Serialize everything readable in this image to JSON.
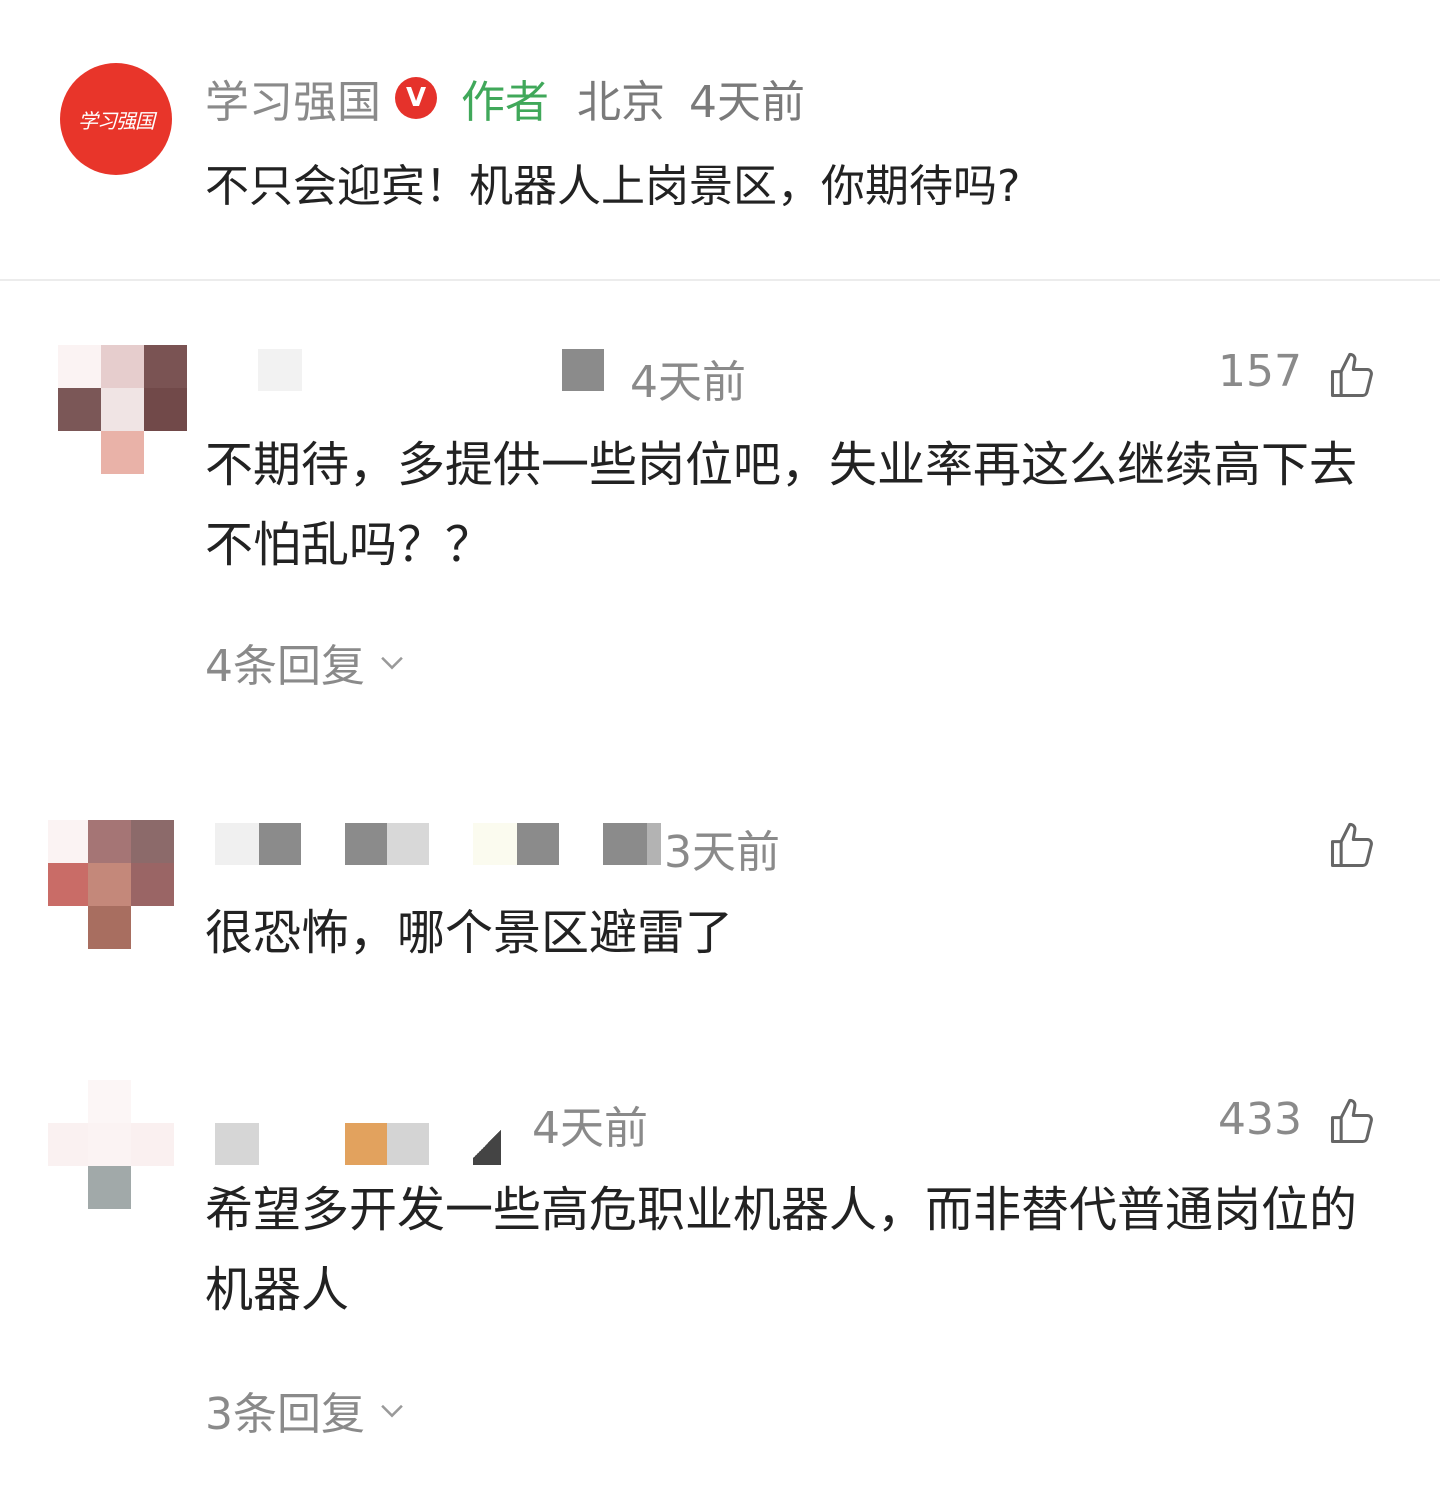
{
  "post": {
    "avatar_label": "学习强国",
    "author": "学习强国",
    "verified_badge": "V",
    "author_tag": "作者",
    "location": "北京",
    "time": "4天前",
    "title": "不只会迎宾！机器人上岗景区，你期待吗?"
  },
  "comments": [
    {
      "time": "4天前",
      "likes": "157",
      "text": "不期待，多提供一些岗位吧，失业率再这么继续高下去不怕乱吗？？",
      "replies": "4条回复"
    },
    {
      "time": "3天前",
      "likes": "",
      "text": "很恐怖，哪个景区避雷了",
      "replies": ""
    },
    {
      "time": "4天前",
      "likes": "433",
      "text": "希望多开发一些高危职业机器人，而非替代普通岗位的机器人",
      "replies": "3条回复"
    }
  ],
  "icons": {
    "like": "thumbs-up-icon",
    "expand": "chevron-down-icon",
    "verified": "verified-badge-icon"
  },
  "colors": {
    "brand_red": "#e8352a",
    "author_green": "#40a85a",
    "meta_gray": "#8a8a8a",
    "text": "#222222"
  }
}
